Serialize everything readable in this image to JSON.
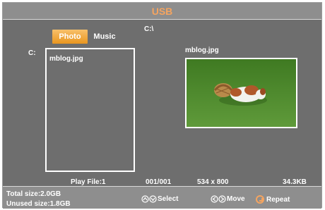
{
  "header": {
    "title": "USB"
  },
  "tabs": [
    {
      "label": "Photo",
      "active": true
    },
    {
      "label": "Music",
      "active": false
    }
  ],
  "path": "C:\\",
  "drive_label": "C:",
  "file_list": [
    {
      "name": "mblog.jpg"
    }
  ],
  "preview": {
    "filename": "mblog.jpg",
    "image": "photo-dog-on-grass"
  },
  "status": {
    "play_file": "Play File:1",
    "index": "001/001",
    "resolution": "534 x 800",
    "size": "34.3KB"
  },
  "footer": {
    "total_size": "Total size:2.0GB",
    "unused_size": "Unused size:1.8GB",
    "hints": {
      "select": "Select",
      "move": "Move",
      "repeat": "Repeat"
    }
  },
  "colors": {
    "accent": "#f4a460",
    "panel": "#6e6e6e",
    "bar": "#8e8e8e",
    "tab_active": "#e99620"
  }
}
